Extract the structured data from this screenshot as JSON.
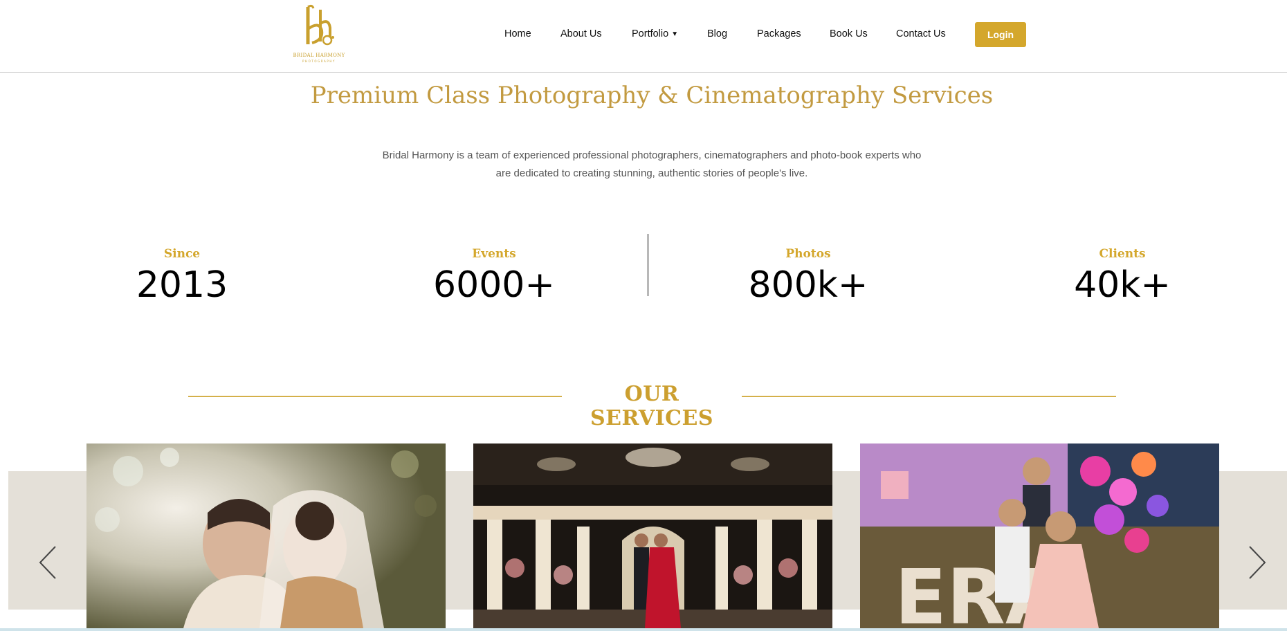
{
  "brand": {
    "logo_icon": "bh-monogram-logo",
    "name": "BRIDAL HARMONY",
    "tagline": "PHOTOGRAPHY",
    "accent_color": "#d4a72c"
  },
  "nav": {
    "items": [
      {
        "label": "Home"
      },
      {
        "label": "About Us"
      },
      {
        "label": "Portfolio"
      },
      {
        "label": "Blog"
      },
      {
        "label": "Packages"
      },
      {
        "label": "Book Us"
      },
      {
        "label": "Contact Us"
      }
    ],
    "login_label": "Login"
  },
  "intro": {
    "headline": "Premium Class Photography & Cinematography Services",
    "description": "Bridal Harmony is a team of experienced professional photographers, cinematographers and photo-book experts who are dedicated to creating stunning, authentic stories of people's live."
  },
  "stats": [
    {
      "label": "Since",
      "value": "2013"
    },
    {
      "label": "Events",
      "value": "6000+"
    },
    {
      "label": "Photos",
      "value": "800k+"
    },
    {
      "label": "Clients",
      "value": "40k+"
    }
  ],
  "services": {
    "title": "OUR SERVICES",
    "cards": [
      {
        "name": "couple-photo"
      },
      {
        "name": "wedding-stage-photo"
      },
      {
        "name": "kids-birthday-photo"
      }
    ],
    "prev_icon": "chevron-left-icon",
    "next_icon": "chevron-right-icon"
  }
}
